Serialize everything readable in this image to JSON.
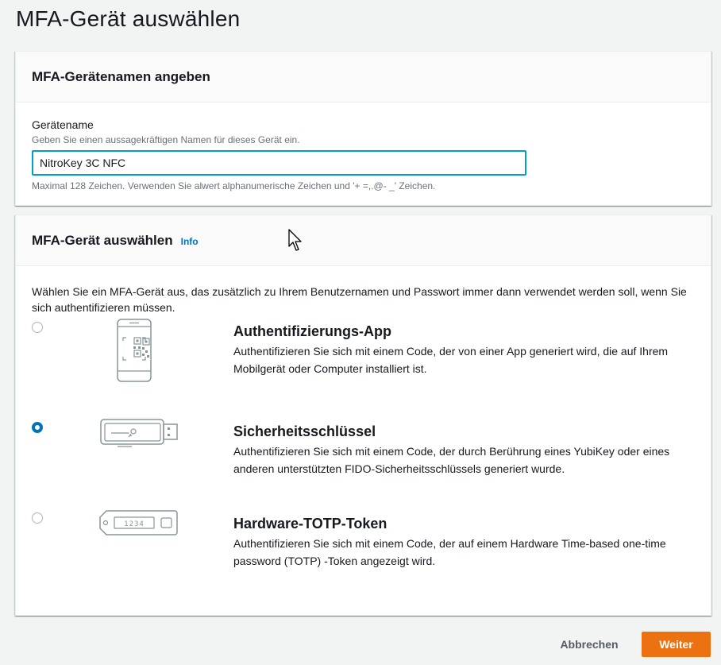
{
  "page": {
    "title": "MFA-Gerät auswählen"
  },
  "name_panel": {
    "title": "MFA-Gerätenamen angeben",
    "field_label": "Gerätename",
    "field_description": "Geben Sie einen aussagekräftigen Namen für dieses Gerät ein.",
    "field_value": "NitroKey 3C NFC",
    "field_constraint": "Maximal 128 Zeichen. Verwenden Sie alwert alphanumerische Zeichen und '+ =,.@- _' Zeichen."
  },
  "device_panel": {
    "title": "MFA-Gerät auswählen",
    "info_link": "Info",
    "intro": "Wählen Sie ein MFA-Gerät aus, das zusätzlich zu Ihrem Benutzernamen und Passwort immer dann verwendet werden soll, wenn Sie sich authentifizieren müssen.",
    "options": [
      {
        "title": "Authentifizierungs-App",
        "description": "Authentifizieren Sie sich mit einem Code, der von einer App generiert wird, die auf Ihrem Mobilgerät oder Computer installiert ist.",
        "selected": false,
        "icon": "phone-qr-icon"
      },
      {
        "title": "Sicherheitsschlüssel",
        "description": "Authentifizieren Sie sich mit einem Code, der durch Berührung eines YubiKey oder eines anderen unterstützten FIDO-Sicherheitsschlüssels generiert wurde.",
        "selected": true,
        "icon": "usb-key-icon"
      },
      {
        "title": "Hardware-TOTP-Token",
        "description": "Authentifizieren Sie sich mit einem Code, der auf einem Hardware Time-based one-time password (TOTP) -Token angezeigt wird.",
        "selected": false,
        "icon": "totp-token-icon",
        "token_display": "1234"
      }
    ]
  },
  "footer": {
    "cancel_label": "Abbrechen",
    "next_label": "Weiter"
  },
  "colors": {
    "accent": "#0073bb",
    "primary_button": "#ec7211",
    "input_focus": "#00a1c9"
  }
}
